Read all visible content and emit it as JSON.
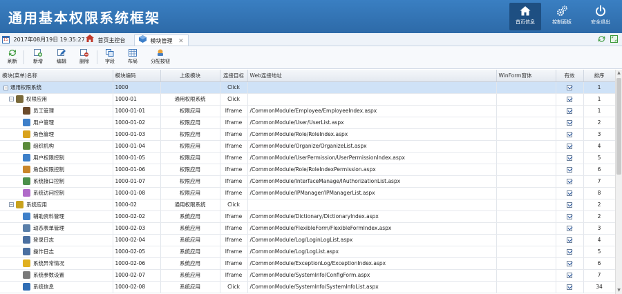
{
  "header": {
    "title": "通用基本权限系统框架",
    "buttons": [
      {
        "label": "首页信息",
        "icon": "home-icon"
      },
      {
        "label": "控制面板",
        "icon": "gears-icon"
      },
      {
        "label": "安全退出",
        "icon": "power-icon"
      }
    ]
  },
  "tabs": {
    "datetime": "2017年08月19日 19:35:27",
    "date_badge": "15",
    "home_tab": "首页主控台",
    "active_tab": "模块管理",
    "close": "✕"
  },
  "toolbar": {
    "buttons": [
      {
        "label": "刷新",
        "icon": "refresh-icon",
        "color": "#3c9a3c"
      },
      {
        "label": "新增",
        "icon": "add-icon",
        "color": "#3c9a3c"
      },
      {
        "label": "编辑",
        "icon": "edit-icon",
        "color": "#2f6db5"
      },
      {
        "label": "删除",
        "icon": "delete-icon",
        "color": "#c0392b"
      },
      {
        "label": "字段",
        "icon": "field-icon",
        "color": "#2f6db5"
      },
      {
        "label": "布局",
        "icon": "layout-icon",
        "color": "#4a7fbf"
      },
      {
        "label": "分配按钮",
        "icon": "assign-icon",
        "color": "#d98a1c"
      }
    ]
  },
  "grid": {
    "columns": [
      "模块(菜单)名称",
      "模块编码",
      "上级模块",
      "连接目标",
      "Web连接地址",
      "WinForm窗体",
      "有效",
      "排序"
    ],
    "rows": [
      {
        "level": 0,
        "toggle": "−",
        "name": "通用权限系统",
        "code": "1000",
        "parent": "",
        "target": "Click",
        "url": "",
        "winform": "",
        "sort": "1",
        "icon": "",
        "icolor": ""
      },
      {
        "level": 1,
        "toggle": "−",
        "name": "权限应用",
        "code": "1000-01",
        "parent": "通用权限系统",
        "target": "Click",
        "url": "",
        "winform": "",
        "sort": "1",
        "icon": "eye-icon",
        "icolor": "#7a6a3a"
      },
      {
        "level": 2,
        "toggle": "",
        "name": "员工管理",
        "code": "1000-01-01",
        "parent": "权限应用",
        "target": "Iframe",
        "url": "/CommonModule/Employee/EmployeeIndex.aspx",
        "winform": "",
        "sort": "1",
        "icon": "employee-icon",
        "icolor": "#6b4a2a"
      },
      {
        "level": 2,
        "toggle": "",
        "name": "用户管理",
        "code": "1000-01-02",
        "parent": "权限应用",
        "target": "Iframe",
        "url": "/CommonModule/User/UserList.aspx",
        "winform": "",
        "sort": "2",
        "icon": "user-icon",
        "icolor": "#3d7fc9"
      },
      {
        "level": 2,
        "toggle": "",
        "name": "角色管理",
        "code": "1000-01-03",
        "parent": "权限应用",
        "target": "Iframe",
        "url": "/CommonModule/Role/RoleIndex.aspx",
        "winform": "",
        "sort": "3",
        "icon": "role-icon",
        "icolor": "#d9a21c"
      },
      {
        "level": 2,
        "toggle": "",
        "name": "组织机构",
        "code": "1000-01-04",
        "parent": "权限应用",
        "target": "Iframe",
        "url": "/CommonModule/Organize/OrganizeList.aspx",
        "winform": "",
        "sort": "4",
        "icon": "organize-icon",
        "icolor": "#5a8a3a"
      },
      {
        "level": 2,
        "toggle": "",
        "name": "用户权限控制",
        "code": "1000-01-05",
        "parent": "权限应用",
        "target": "Iframe",
        "url": "/CommonModule/UserPermission/UserPermissionIndex.aspx",
        "winform": "",
        "sort": "5",
        "icon": "user-permission-icon",
        "icolor": "#3d7fc9"
      },
      {
        "level": 2,
        "toggle": "",
        "name": "角色权限控制",
        "code": "1000-01-06",
        "parent": "权限应用",
        "target": "Iframe",
        "url": "/CommonModule/Role/RoleIndexPermission.aspx",
        "winform": "",
        "sort": "6",
        "icon": "role-permission-icon",
        "icolor": "#c9862a"
      },
      {
        "level": 2,
        "toggle": "",
        "name": "系统接口控制",
        "code": "1000-01-07",
        "parent": "权限应用",
        "target": "Iframe",
        "url": "/CommonModule/InterfaceManage/IAuthorizationList.aspx",
        "winform": "",
        "sort": "7",
        "icon": "interface-icon",
        "icolor": "#4a8f4a"
      },
      {
        "level": 2,
        "toggle": "",
        "name": "系统访问控制",
        "code": "1000-01-08",
        "parent": "权限应用",
        "target": "Iframe",
        "url": "/CommonModule/IPManager/IPManagerList.aspx",
        "winform": "",
        "sort": "8",
        "icon": "access-icon",
        "icolor": "#b06ac9"
      },
      {
        "level": 1,
        "toggle": "−",
        "name": "系统应用",
        "code": "1000-02",
        "parent": "通用权限系统",
        "target": "Click",
        "url": "",
        "winform": "",
        "sort": "2",
        "icon": "system-app-icon",
        "icolor": "#c9a21c"
      },
      {
        "level": 2,
        "toggle": "",
        "name": "辅助资料管理",
        "code": "1000-02-02",
        "parent": "系统应用",
        "target": "Iframe",
        "url": "/CommonModule/Dictionary/DictionaryIndex.aspx",
        "winform": "",
        "sort": "2",
        "icon": "dictionary-icon",
        "icolor": "#3d7fc9"
      },
      {
        "level": 2,
        "toggle": "",
        "name": "动态表单管理",
        "code": "1000-02-03",
        "parent": "系统应用",
        "target": "Iframe",
        "url": "/CommonModule/FlexibleForm/FlexibleFormIndex.aspx",
        "winform": "",
        "sort": "3",
        "icon": "form-icon",
        "icolor": "#5a7fa9"
      },
      {
        "level": 2,
        "toggle": "",
        "name": "登录日志",
        "code": "1000-02-04",
        "parent": "系统应用",
        "target": "Iframe",
        "url": "/CommonModule/Log/LoginLogList.aspx",
        "winform": "",
        "sort": "4",
        "icon": "login-log-icon",
        "icolor": "#4a6fa0"
      },
      {
        "level": 2,
        "toggle": "",
        "name": "操作日志",
        "code": "1000-02-05",
        "parent": "系统应用",
        "target": "Iframe",
        "url": "/CommonModule/Log/LogList.aspx",
        "winform": "",
        "sort": "5",
        "icon": "operation-log-icon",
        "icolor": "#4a6fa0"
      },
      {
        "level": 2,
        "toggle": "",
        "name": "系统异常情况",
        "code": "1000-02-06",
        "parent": "系统应用",
        "target": "Iframe",
        "url": "/CommonModule/ExceptionLog/ExceptionIndex.aspx",
        "winform": "",
        "sort": "6",
        "icon": "warning-icon",
        "icolor": "#e0b020"
      },
      {
        "level": 2,
        "toggle": "",
        "name": "系统参数设置",
        "code": "1000-02-07",
        "parent": "系统应用",
        "target": "Iframe",
        "url": "/CommonModule/SystemInfo/ConfigForm.aspx",
        "winform": "",
        "sort": "7",
        "icon": "settings-icon",
        "icolor": "#7a7a7a"
      },
      {
        "level": 2,
        "toggle": "",
        "name": "系统信息",
        "code": "1000-02-08",
        "parent": "系统应用",
        "target": "Click",
        "url": "/CommonModule/SystemInfo/SystemInfoList.aspx",
        "winform": "",
        "sort": "34",
        "icon": "info-icon",
        "icolor": "#2f6db5"
      }
    ]
  }
}
